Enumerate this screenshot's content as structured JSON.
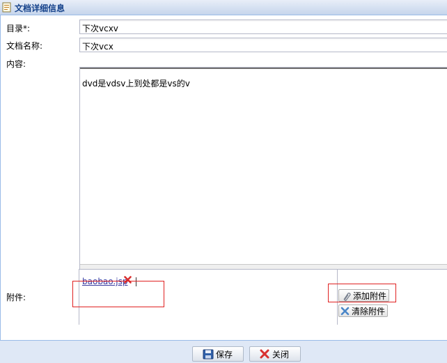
{
  "window": {
    "title": "文档详细信息"
  },
  "form": {
    "directory": {
      "label": "目录*:",
      "value": "下次vcxv"
    },
    "doc_name": {
      "label": "文档名称:",
      "value": "下次vcx"
    },
    "content": {
      "label": "内容:",
      "value": "dvd是vdsv上到处都是vs的v"
    },
    "attachment": {
      "label": "附件:",
      "file_name": "baobao.jsp",
      "add_label": "添加附件",
      "clear_label": "清除附件"
    }
  },
  "footer": {
    "save_label": "保存",
    "close_label": "关闭"
  },
  "colors": {
    "header_text": "#15428b",
    "highlight_box": "#e02020",
    "remove_icon": "#d83030"
  },
  "icons": {
    "header": "document-icon",
    "remove": "close-x-icon",
    "add": "paperclip-icon",
    "clear": "close-x-icon",
    "save": "floppy-disk-icon",
    "close": "close-x-icon"
  }
}
